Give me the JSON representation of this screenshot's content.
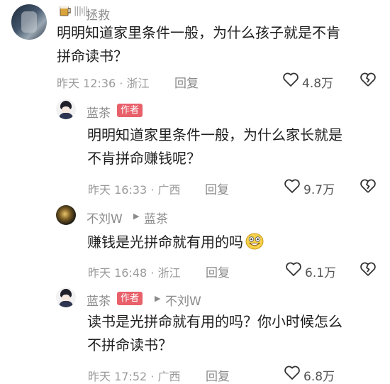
{
  "comments": [
    {
      "author": "拯救",
      "text_lines": [
        "明明知道家里条件一般，为什么孩子就是不肯",
        "拼命读书？"
      ],
      "time": "昨天 12:36 · 浙江",
      "reply_label": "回复",
      "likes": "4.8万"
    },
    {
      "author": "蓝茶",
      "badge": "作者",
      "text_lines": [
        "明明知道家里条件一般，为什么家长就是",
        "不肯拼命赚钱呢？"
      ],
      "time": "昨天 16:33 · 广西",
      "reply_label": "回复",
      "likes": "9.7万"
    },
    {
      "author": "不刘W",
      "reply_to": "蓝茶",
      "text_lines": [
        "赚钱是光拼命就有用的吗"
      ],
      "time": "昨天 16:48 · 浙江",
      "reply_label": "回复",
      "likes": "6.1万"
    },
    {
      "author": "蓝茶",
      "badge": "作者",
      "reply_to": "不刘W",
      "text_lines": [
        "读书是光拼命就有用的吗？你小时候怎么",
        "不拼命读书？"
      ],
      "time": "昨天 17:52 · 广西",
      "reply_label": "回复",
      "likes": "6.8万"
    }
  ],
  "colors": {
    "badge": "#e8606a",
    "meta": "#9a9a9a",
    "text": "#1e1e1e"
  },
  "icons": [
    "heart-outline-icon",
    "broken-heart-icon",
    "grin-emoji-icon",
    "beer-mug-icon"
  ]
}
